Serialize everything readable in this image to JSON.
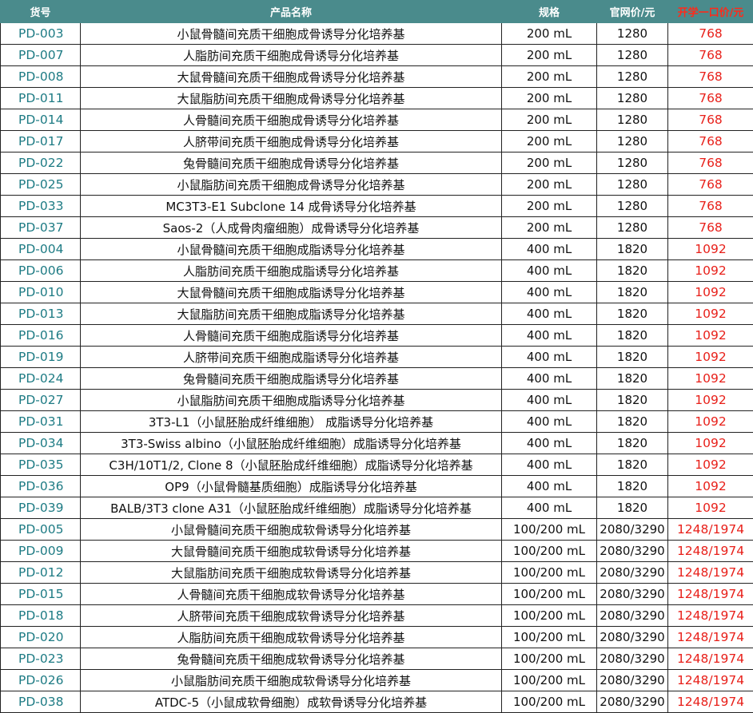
{
  "headers": {
    "code": "货号",
    "name": "产品名称",
    "spec": "规格",
    "price": "官网价/元",
    "promo": "开学一口价/元"
  },
  "rows": [
    {
      "code": "PD-003",
      "name": "小鼠骨髓间充质干细胞成骨诱导分化培养基",
      "spec": "200 mL",
      "price": "1280",
      "promo": "768"
    },
    {
      "code": "PD-007",
      "name": "人脂肪间充质干细胞成骨诱导分化培养基",
      "spec": "200 mL",
      "price": "1280",
      "promo": "768"
    },
    {
      "code": "PD-008",
      "name": "大鼠骨髓间充质干细胞成骨诱导分化培养基",
      "spec": "200 mL",
      "price": "1280",
      "promo": "768"
    },
    {
      "code": "PD-011",
      "name": "大鼠脂肪间充质干细胞成骨诱导分化培养基",
      "spec": "200 mL",
      "price": "1280",
      "promo": "768"
    },
    {
      "code": "PD-014",
      "name": "人骨髓间充质干细胞成骨诱导分化培养基",
      "spec": "200 mL",
      "price": "1280",
      "promo": "768"
    },
    {
      "code": "PD-017",
      "name": "人脐带间充质干细胞成骨诱导分化培养基",
      "spec": "200 mL",
      "price": "1280",
      "promo": "768"
    },
    {
      "code": "PD-022",
      "name": "兔骨髓间充质干细胞成骨诱导分化培养基",
      "spec": "200 mL",
      "price": "1280",
      "promo": "768"
    },
    {
      "code": "PD-025",
      "name": "小鼠脂肪间充质干细胞成骨诱导分化培养基",
      "spec": "200 mL",
      "price": "1280",
      "promo": "768"
    },
    {
      "code": "PD-033",
      "name": "MC3T3-E1 Subclone 14 成骨诱导分化培养基",
      "spec": "200 mL",
      "price": "1280",
      "promo": "768"
    },
    {
      "code": "PD-037",
      "name": "Saos-2（人成骨肉瘤细胞）成骨诱导分化培养基",
      "spec": "200 mL",
      "price": "1280",
      "promo": "768"
    },
    {
      "code": "PD-004",
      "name": "小鼠骨髓间充质干细胞成脂诱导分化培养基",
      "spec": "400 mL",
      "price": "1820",
      "promo": "1092"
    },
    {
      "code": "PD-006",
      "name": "人脂肪间充质干细胞成脂诱导分化培养基",
      "spec": "400 mL",
      "price": "1820",
      "promo": "1092"
    },
    {
      "code": "PD-010",
      "name": "大鼠骨髓间充质干细胞成脂诱导分化培养基",
      "spec": "400 mL",
      "price": "1820",
      "promo": "1092"
    },
    {
      "code": "PD-013",
      "name": "大鼠脂肪间充质干细胞成脂诱导分化培养基",
      "spec": "400 mL",
      "price": "1820",
      "promo": "1092"
    },
    {
      "code": "PD-016",
      "name": "人骨髓间充质干细胞成脂诱导分化培养基",
      "spec": "400 mL",
      "price": "1820",
      "promo": "1092"
    },
    {
      "code": "PD-019",
      "name": "人脐带间充质干细胞成脂诱导分化培养基",
      "spec": "400 mL",
      "price": "1820",
      "promo": "1092"
    },
    {
      "code": "PD-024",
      "name": "兔骨髓间充质干细胞成脂诱导分化培养基",
      "spec": "400 mL",
      "price": "1820",
      "promo": "1092"
    },
    {
      "code": "PD-027",
      "name": "小鼠脂肪间充质干细胞成脂诱导分化培养基",
      "spec": "400 mL",
      "price": "1820",
      "promo": "1092"
    },
    {
      "code": "PD-031",
      "name": "3T3-L1（小鼠胚胎成纤维细胞） 成脂诱导分化培养基",
      "spec": "400 mL",
      "price": "1820",
      "promo": "1092"
    },
    {
      "code": "PD-034",
      "name": "3T3-Swiss albino（小鼠胚胎成纤维细胞）成脂诱导分化培养基",
      "spec": "400 mL",
      "price": "1820",
      "promo": "1092"
    },
    {
      "code": "PD-035",
      "name": "C3H/10T1/2, Clone 8（小鼠胚胎成纤维细胞）成脂诱导分化培养基",
      "spec": "400 mL",
      "price": "1820",
      "promo": "1092"
    },
    {
      "code": "PD-036",
      "name": "OP9（小鼠骨髓基质细胞）成脂诱导分化培养基",
      "spec": "400 mL",
      "price": "1820",
      "promo": "1092"
    },
    {
      "code": "PD-039",
      "name": "BALB/3T3 clone A31（小鼠胚胎成纤维细胞）成脂诱导分化培养基",
      "spec": "400 mL",
      "price": "1820",
      "promo": "1092"
    },
    {
      "code": "PD-005",
      "name": "小鼠骨髓间充质干细胞成软骨诱导分化培养基",
      "spec": "100/200 mL",
      "price": "2080/3290",
      "promo": "1248/1974"
    },
    {
      "code": "PD-009",
      "name": "大鼠骨髓间充质干细胞成软骨诱导分化培养基",
      "spec": "100/200 mL",
      "price": "2080/3290",
      "promo": "1248/1974"
    },
    {
      "code": "PD-012",
      "name": "大鼠脂肪间充质干细胞成软骨诱导分化培养基",
      "spec": "100/200 mL",
      "price": "2080/3290",
      "promo": "1248/1974"
    },
    {
      "code": "PD-015",
      "name": "人骨髓间充质干细胞成软骨诱导分化培养基",
      "spec": "100/200 mL",
      "price": "2080/3290",
      "promo": "1248/1974"
    },
    {
      "code": "PD-018",
      "name": "人脐带间充质干细胞成软骨诱导分化培养基",
      "spec": "100/200 mL",
      "price": "2080/3290",
      "promo": "1248/1974"
    },
    {
      "code": "PD-020",
      "name": "人脂肪间充质干细胞成软骨诱导分化培养基",
      "spec": "100/200 mL",
      "price": "2080/3290",
      "promo": "1248/1974"
    },
    {
      "code": "PD-023",
      "name": "兔骨髓间充质干细胞成软骨诱导分化培养基",
      "spec": "100/200 mL",
      "price": "2080/3290",
      "promo": "1248/1974"
    },
    {
      "code": "PD-026",
      "name": "小鼠脂肪间充质干细胞成软骨诱导分化培养基",
      "spec": "100/200 mL",
      "price": "2080/3290",
      "promo": "1248/1974"
    },
    {
      "code": "PD-038",
      "name": "ATDC-5（小鼠成软骨细胞）成软骨诱导分化培养基",
      "spec": "100/200 mL",
      "price": "2080/3290",
      "promo": "1248/1974"
    }
  ]
}
